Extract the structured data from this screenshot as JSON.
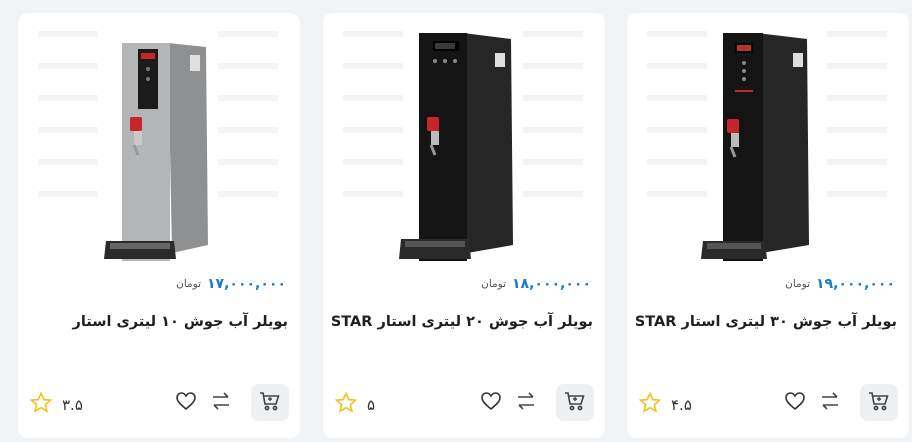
{
  "currency": "تومان",
  "products": [
    {
      "title": "بویلر آب جوش ۳۰ لیتری استار STAR",
      "price": "۱۹,۰۰۰,۰۰۰",
      "rating": "۴.۵",
      "body_color": "#1c1c1c",
      "tap_color": "#c8242b"
    },
    {
      "title": "بویلر آب جوش ۲۰ لیتری استار STAR",
      "price": "۱۸,۰۰۰,۰۰۰",
      "rating": "۵",
      "body_color": "#1c1c1c",
      "tap_color": "#c8242b"
    },
    {
      "title": "بویلر آب جوش ۱۰ لیتری استار",
      "price": "۱۷,۰۰۰,۰۰۰",
      "rating": "۳.۵",
      "body_color": "#a7a9ab",
      "tap_color": "#c8242b"
    }
  ],
  "icons": {
    "cart": "cart-icon",
    "compare": "compare-arrows-icon",
    "wishlist": "heart-icon",
    "rating": "star-icon"
  },
  "colors": {
    "price": "#1d79c9",
    "star": "#f2c21b",
    "card_bg": "#ffffff",
    "page_bg": "#f2f3f5"
  }
}
